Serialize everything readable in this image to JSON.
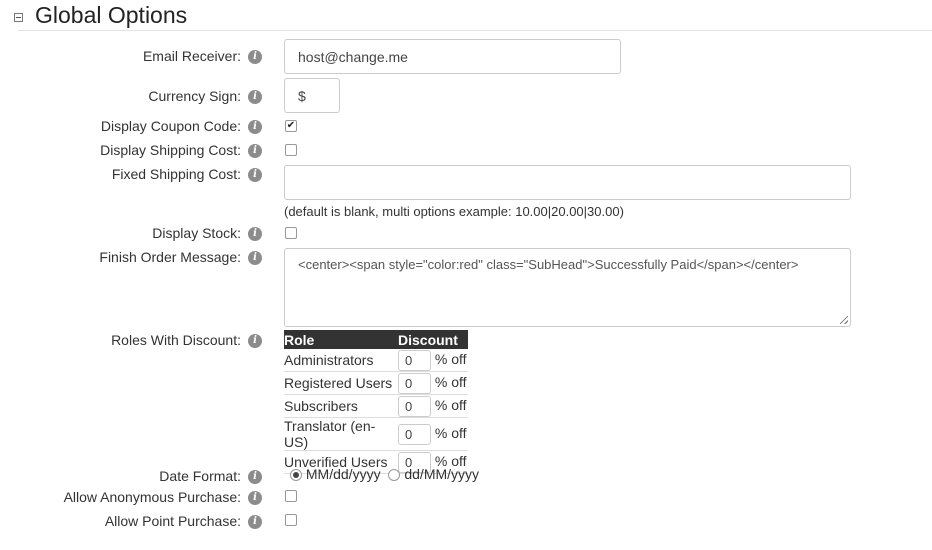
{
  "section": {
    "title": "Global Options",
    "collapse_icon": "minus-box-icon"
  },
  "fields": {
    "email_receiver": {
      "label": "Email Receiver:",
      "value": "host@change.me"
    },
    "currency_sign": {
      "label": "Currency Sign:",
      "value": "$"
    },
    "display_coupon_code": {
      "label": "Display Coupon Code:",
      "checked": true
    },
    "display_shipping_cost": {
      "label": "Display Shipping Cost:",
      "checked": false
    },
    "fixed_shipping_cost": {
      "label": "Fixed Shipping Cost:",
      "value": "",
      "hint": "(default is blank, multi options example: 10.00|20.00|30.00)"
    },
    "display_stock": {
      "label": "Display Stock:",
      "checked": false
    },
    "finish_order_message": {
      "label": "Finish Order Message:",
      "value": "<center><span style=\"color:red\" class=\"SubHead\">Successfully Paid</span></center>"
    },
    "roles_with_discount": {
      "label": "Roles With Discount:",
      "col_role": "Role",
      "col_discount": "Discount",
      "suffix": "% off",
      "rows": [
        {
          "role": "Administrators",
          "value": "0"
        },
        {
          "role": "Registered Users",
          "value": "0"
        },
        {
          "role": "Subscribers",
          "value": "0"
        },
        {
          "role": "Translator (en-US)",
          "value": "0"
        },
        {
          "role": "Unverified Users",
          "value": "0"
        }
      ]
    },
    "date_format": {
      "label": "Date Format:",
      "options": [
        "MM/dd/yyyy",
        "dd/MM/yyyy"
      ],
      "selected": "MM/dd/yyyy"
    },
    "allow_anonymous_purchase": {
      "label": "Allow Anonymous Purchase:",
      "checked": false
    },
    "allow_point_purchase": {
      "label": "Allow Point Purchase:",
      "checked": false
    }
  },
  "icons": {
    "info": "info-icon",
    "check": "checkmark-icon"
  },
  "info_glyph": "i",
  "check_glyph": "✔"
}
